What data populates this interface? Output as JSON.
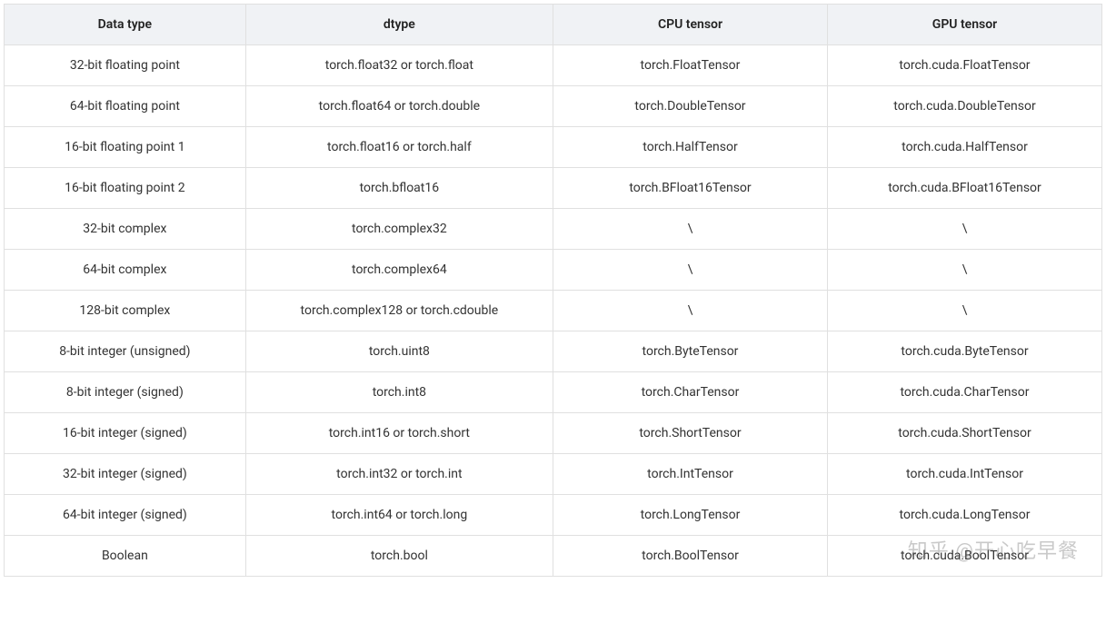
{
  "table": {
    "headers": {
      "datatype": "Data type",
      "dtype": "dtype",
      "cpu": "CPU tensor",
      "gpu": "GPU tensor"
    },
    "rows": [
      {
        "datatype": "32-bit floating point",
        "dtype": "torch.float32 or torch.float",
        "cpu": "torch.FloatTensor",
        "gpu": "torch.cuda.FloatTensor"
      },
      {
        "datatype": "64-bit floating point",
        "dtype": "torch.float64 or torch.double",
        "cpu": "torch.DoubleTensor",
        "gpu": "torch.cuda.DoubleTensor"
      },
      {
        "datatype": "16-bit floating point 1",
        "dtype": "torch.float16 or torch.half",
        "cpu": "torch.HalfTensor",
        "gpu": "torch.cuda.HalfTensor"
      },
      {
        "datatype": "16-bit floating point 2",
        "dtype": "torch.bfloat16",
        "cpu": "torch.BFloat16Tensor",
        "gpu": "torch.cuda.BFloat16Tensor"
      },
      {
        "datatype": "32-bit complex",
        "dtype": "torch.complex32",
        "cpu": "\\",
        "gpu": "\\"
      },
      {
        "datatype": "64-bit complex",
        "dtype": "torch.complex64",
        "cpu": "\\",
        "gpu": "\\"
      },
      {
        "datatype": "128-bit complex",
        "dtype": "torch.complex128 or torch.cdouble",
        "cpu": "\\",
        "gpu": "\\"
      },
      {
        "datatype": "8-bit integer (unsigned)",
        "dtype": "torch.uint8",
        "cpu": "torch.ByteTensor",
        "gpu": "torch.cuda.ByteTensor"
      },
      {
        "datatype": "8-bit integer (signed)",
        "dtype": "torch.int8",
        "cpu": "torch.CharTensor",
        "gpu": "torch.cuda.CharTensor"
      },
      {
        "datatype": "16-bit integer (signed)",
        "dtype": "torch.int16 or torch.short",
        "cpu": "torch.ShortTensor",
        "gpu": "torch.cuda.ShortTensor"
      },
      {
        "datatype": "32-bit integer (signed)",
        "dtype": "torch.int32 or torch.int",
        "cpu": "torch.IntTensor",
        "gpu": "torch.cuda.IntTensor"
      },
      {
        "datatype": "64-bit integer (signed)",
        "dtype": "torch.int64 or torch.long",
        "cpu": "torch.LongTensor",
        "gpu": "torch.cuda.LongTensor"
      },
      {
        "datatype": "Boolean",
        "dtype": "torch.bool",
        "cpu": "torch.BoolTensor",
        "gpu": "torch.cuda.BoolTensor"
      }
    ]
  },
  "watermark": "知乎 @开心吃早餐"
}
